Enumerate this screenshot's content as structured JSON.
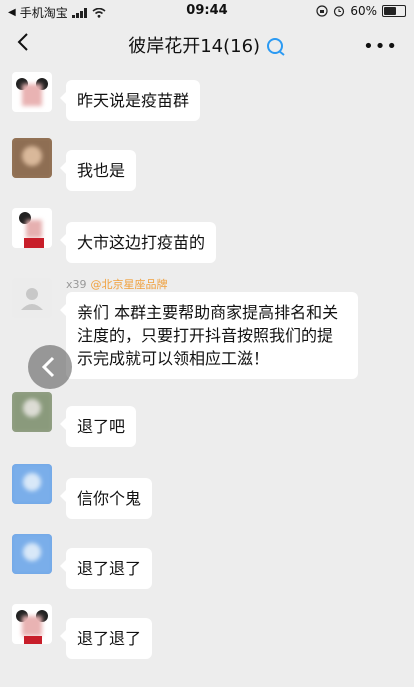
{
  "status_bar": {
    "carrier": "手机淘宝",
    "time": "09:44",
    "battery": "60%",
    "battery_level": 0.6
  },
  "nav": {
    "title": "彼岸花开14(16)"
  },
  "messages": [
    {
      "sender": "",
      "text": "昨天说是疫苗群"
    },
    {
      "sender": "",
      "text": "我也是"
    },
    {
      "sender": "",
      "text": "大市这边打疫苗的"
    },
    {
      "sender": "x39",
      "tag": "@北京星座品牌",
      "text": "亲们 本群主要帮助商家提高排名和关注度的，只要打开抖音按照我们的提示完成就可以领相应工滋！"
    },
    {
      "sender": "",
      "text": "退了吧"
    },
    {
      "sender": "",
      "text": "信你个鬼"
    },
    {
      "sender": "",
      "text": "退了退了"
    },
    {
      "sender": "",
      "text": "退了退了"
    }
  ],
  "colors": {
    "background": "#ededed",
    "bubble": "#ffffff",
    "tag": "#f0a03c"
  }
}
